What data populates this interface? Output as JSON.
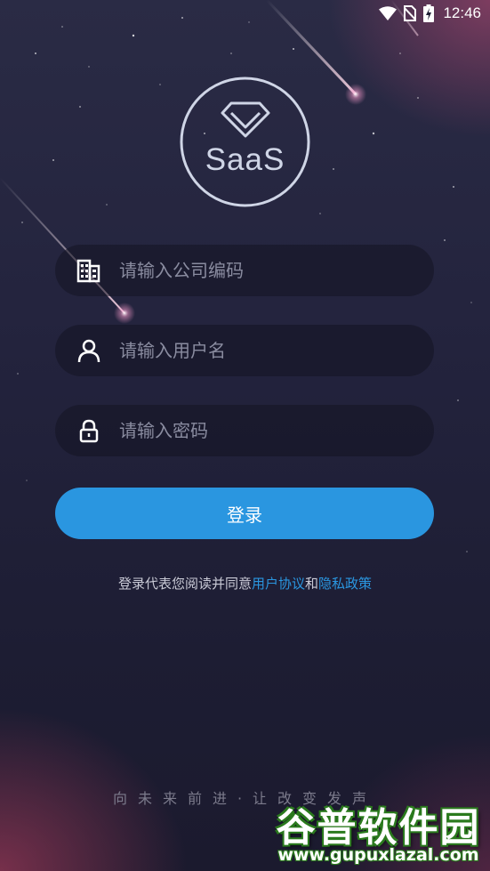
{
  "status_bar": {
    "time": "12:46",
    "icons": [
      "wifi-icon",
      "no-sim-icon",
      "battery-charging-icon"
    ]
  },
  "logo": {
    "text": "SaaS",
    "icon": "diamond-icon"
  },
  "form": {
    "company_field": {
      "placeholder": "请输入公司编码",
      "value": "",
      "icon": "building-icon"
    },
    "username_field": {
      "placeholder": "请输入用户名",
      "value": "",
      "icon": "user-icon"
    },
    "password_field": {
      "placeholder": "请输入密码",
      "value": "",
      "icon": "lock-icon"
    },
    "login_label": "登录"
  },
  "agreement": {
    "prefix": "登录代表您阅读并同意",
    "user_agreement": "用户协议",
    "conjunction": "和",
    "privacy_policy": "隐私政策"
  },
  "slogan": "向未来前进·让改变发声",
  "watermark": {
    "title": "谷普软件园",
    "url": "www.gupuxlazal.com"
  },
  "colors": {
    "accent": "#2a96e0",
    "background": "#23233d",
    "watermark_green": "#2b7a1e"
  }
}
